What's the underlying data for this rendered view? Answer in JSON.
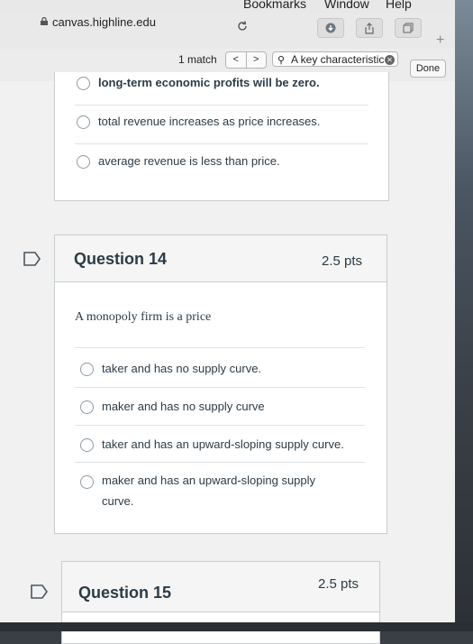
{
  "menu": {
    "bookmarks": "Bookmarks",
    "window": "Window",
    "help": "Help"
  },
  "browser": {
    "url": "canvas.highline.edu"
  },
  "find": {
    "match_count": "1 match",
    "prev": "<",
    "next": ">",
    "query": "A key characteristic",
    "done": "Done"
  },
  "prev_question": {
    "options": [
      "long-term economic profits will be zero.",
      "total revenue increases as price increases.",
      "average revenue is less than price."
    ]
  },
  "q14": {
    "title": "Question 14",
    "points": "2.5 pts",
    "text": "A monopoly firm is a price",
    "options": [
      "taker and has no supply curve.",
      "maker and has no supply curve",
      "taker and has an upward-sloping supply curve.",
      "maker and has an upward-sloping supply",
      "curve."
    ]
  },
  "q15": {
    "title": "Question 15",
    "points": "2.5 pts"
  }
}
